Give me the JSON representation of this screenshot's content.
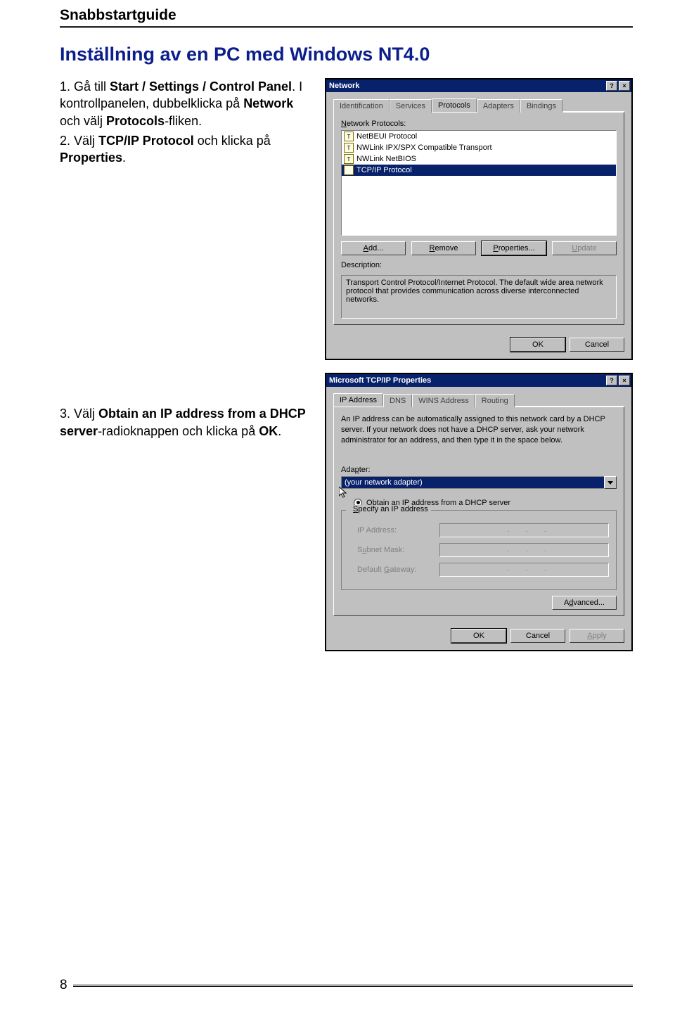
{
  "page": {
    "header": "Snabbstartguide",
    "heading": "Inställning av en PC med Windows NT4.0",
    "page_number": "8"
  },
  "instructions": {
    "step1_a": "1. Gå till ",
    "step1_b": "Start / Settings / Control Panel",
    "step1_c": ". I kontrollpanelen, dubbelklicka på ",
    "step1_d": "Network",
    "step1_e": " och välj ",
    "step1_f": "Protocols",
    "step1_g": "-fliken.",
    "step2_a": "2. Välj ",
    "step2_b": "TCP/IP Protocol",
    "step2_c": " och klicka på ",
    "step2_d": "Properties",
    "step2_e": ".",
    "step3_a": "3. Välj ",
    "step3_b": "Obtain an IP address from a DHCP server",
    "step3_c": "-radioknappen och klicka på ",
    "step3_d": "OK",
    "step3_e": "."
  },
  "win1": {
    "title": "Network",
    "help": "?",
    "close": "×",
    "tabs": [
      "Identification",
      "Services",
      "Protocols",
      "Adapters",
      "Bindings"
    ],
    "list_label": "Network Protocols:",
    "protocols": [
      "NetBEUI Protocol",
      "NWLink IPX/SPX Compatible Transport",
      "NWLink NetBIOS",
      "TCP/IP Protocol"
    ],
    "buttons": {
      "add": "Add...",
      "remove": "Remove",
      "properties": "Properties...",
      "update": "Update"
    },
    "desc_label": "Description:",
    "desc_text": "Transport Control Protocol/Internet Protocol. The default wide area network protocol that provides communication across diverse interconnected networks.",
    "ok": "OK",
    "cancel": "Cancel"
  },
  "win2": {
    "title": "Microsoft TCP/IP Properties",
    "help": "?",
    "close": "×",
    "tabs": [
      "IP Address",
      "DNS",
      "WINS Address",
      "Routing"
    ],
    "intro": "An IP address can be automatically assigned to this network card by a DHCP server. If your network does not have a DHCP server, ask your network administrator for an address, and then type it in the space below.",
    "adapter_label": "Adapter:",
    "adapter_value": "(your network adapter)",
    "radio_dhcp": "Obtain an IP address from a DHCP server",
    "radio_specify": "Specify an IP address",
    "ip_label": "IP Address:",
    "subnet_label": "Subnet Mask:",
    "gateway_label": "Default Gateway:",
    "advanced": "Advanced...",
    "ok": "OK",
    "cancel": "Cancel",
    "apply": "Apply"
  }
}
